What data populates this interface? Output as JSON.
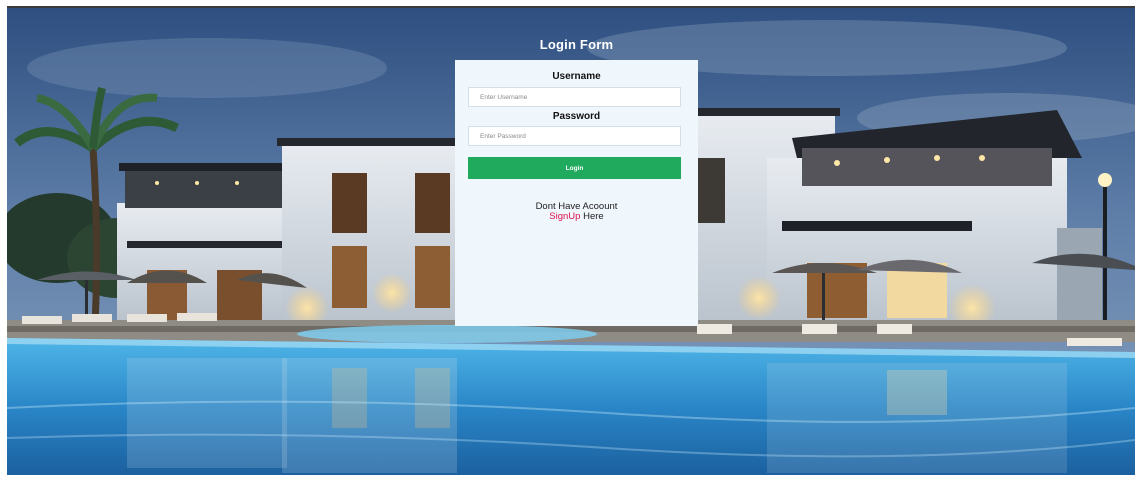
{
  "login": {
    "title": "Login Form",
    "username_label": "Username",
    "username_placeholder": "Enter Username",
    "password_label": "Password",
    "password_placeholder": "Enter Password",
    "login_button": "Login",
    "no_account_text": "Dont Have Acoount",
    "signup_link": "SignUp",
    "signup_suffix": " Here"
  },
  "colors": {
    "panel_bg": "#eff6fc",
    "button_bg": "#1faa5e",
    "link": "#e0124d",
    "title_text": "#ffffff"
  }
}
